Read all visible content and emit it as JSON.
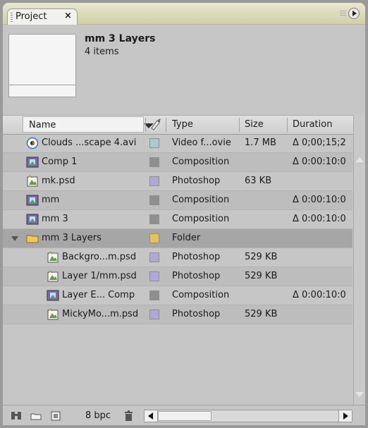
{
  "tab": {
    "label": "Project",
    "close": "×"
  },
  "info": {
    "title": "mm 3 Layers",
    "subtitle": "4 items"
  },
  "columns": {
    "name": "Name",
    "type": "Type",
    "size": "Size",
    "duration": "Duration"
  },
  "rows": [
    {
      "name": "Clouds ...scape 4.avi",
      "icon": "movie-icon",
      "swatch": "#aacccc",
      "type": "Video f...ovie",
      "size": "1.7 MB",
      "duration": "Δ 0;00;15;2",
      "indent": 0
    },
    {
      "name": "Comp 1",
      "icon": "composition-icon",
      "swatch": "#8f8f8f",
      "type": "Composition",
      "size": "",
      "duration": "Δ 0:00:10:0",
      "indent": 0
    },
    {
      "name": "mk.psd",
      "icon": "photoshop-file-icon",
      "swatch": "#b0a8d8",
      "type": "Photoshop",
      "size": "63 KB",
      "duration": "",
      "indent": 0
    },
    {
      "name": "mm",
      "icon": "composition-icon",
      "swatch": "#8f8f8f",
      "type": "Composition",
      "size": "",
      "duration": "Δ 0:00:10:0",
      "indent": 0
    },
    {
      "name": "mm 3",
      "icon": "composition-icon",
      "swatch": "#8f8f8f",
      "type": "Composition",
      "size": "",
      "duration": "Δ 0:00:10:0",
      "indent": 0
    },
    {
      "name": "mm 3 Layers",
      "icon": "folder-icon",
      "swatch": "#e8c060",
      "type": "Folder",
      "size": "",
      "duration": "",
      "indent": 0
    },
    {
      "name": "Backgro...m.psd",
      "icon": "photoshop-file-icon",
      "swatch": "#b0a8d8",
      "type": "Photoshop",
      "size": "529 KB",
      "duration": "",
      "indent": 1
    },
    {
      "name": "Layer 1/mm.psd",
      "icon": "photoshop-file-icon",
      "swatch": "#b0a8d8",
      "type": "Photoshop",
      "size": "529 KB",
      "duration": "",
      "indent": 1
    },
    {
      "name": "Layer E... Comp",
      "icon": "composition-icon",
      "swatch": "#8f8f8f",
      "type": "Composition",
      "size": "",
      "duration": "Δ 0:00:10:0",
      "indent": 1
    },
    {
      "name": "MickyMo...m.psd",
      "icon": "photoshop-file-icon",
      "swatch": "#b0a8d8",
      "type": "Photoshop",
      "size": "529 KB",
      "duration": "",
      "indent": 1
    }
  ],
  "toolbar": {
    "bpc": "8 bpc"
  }
}
